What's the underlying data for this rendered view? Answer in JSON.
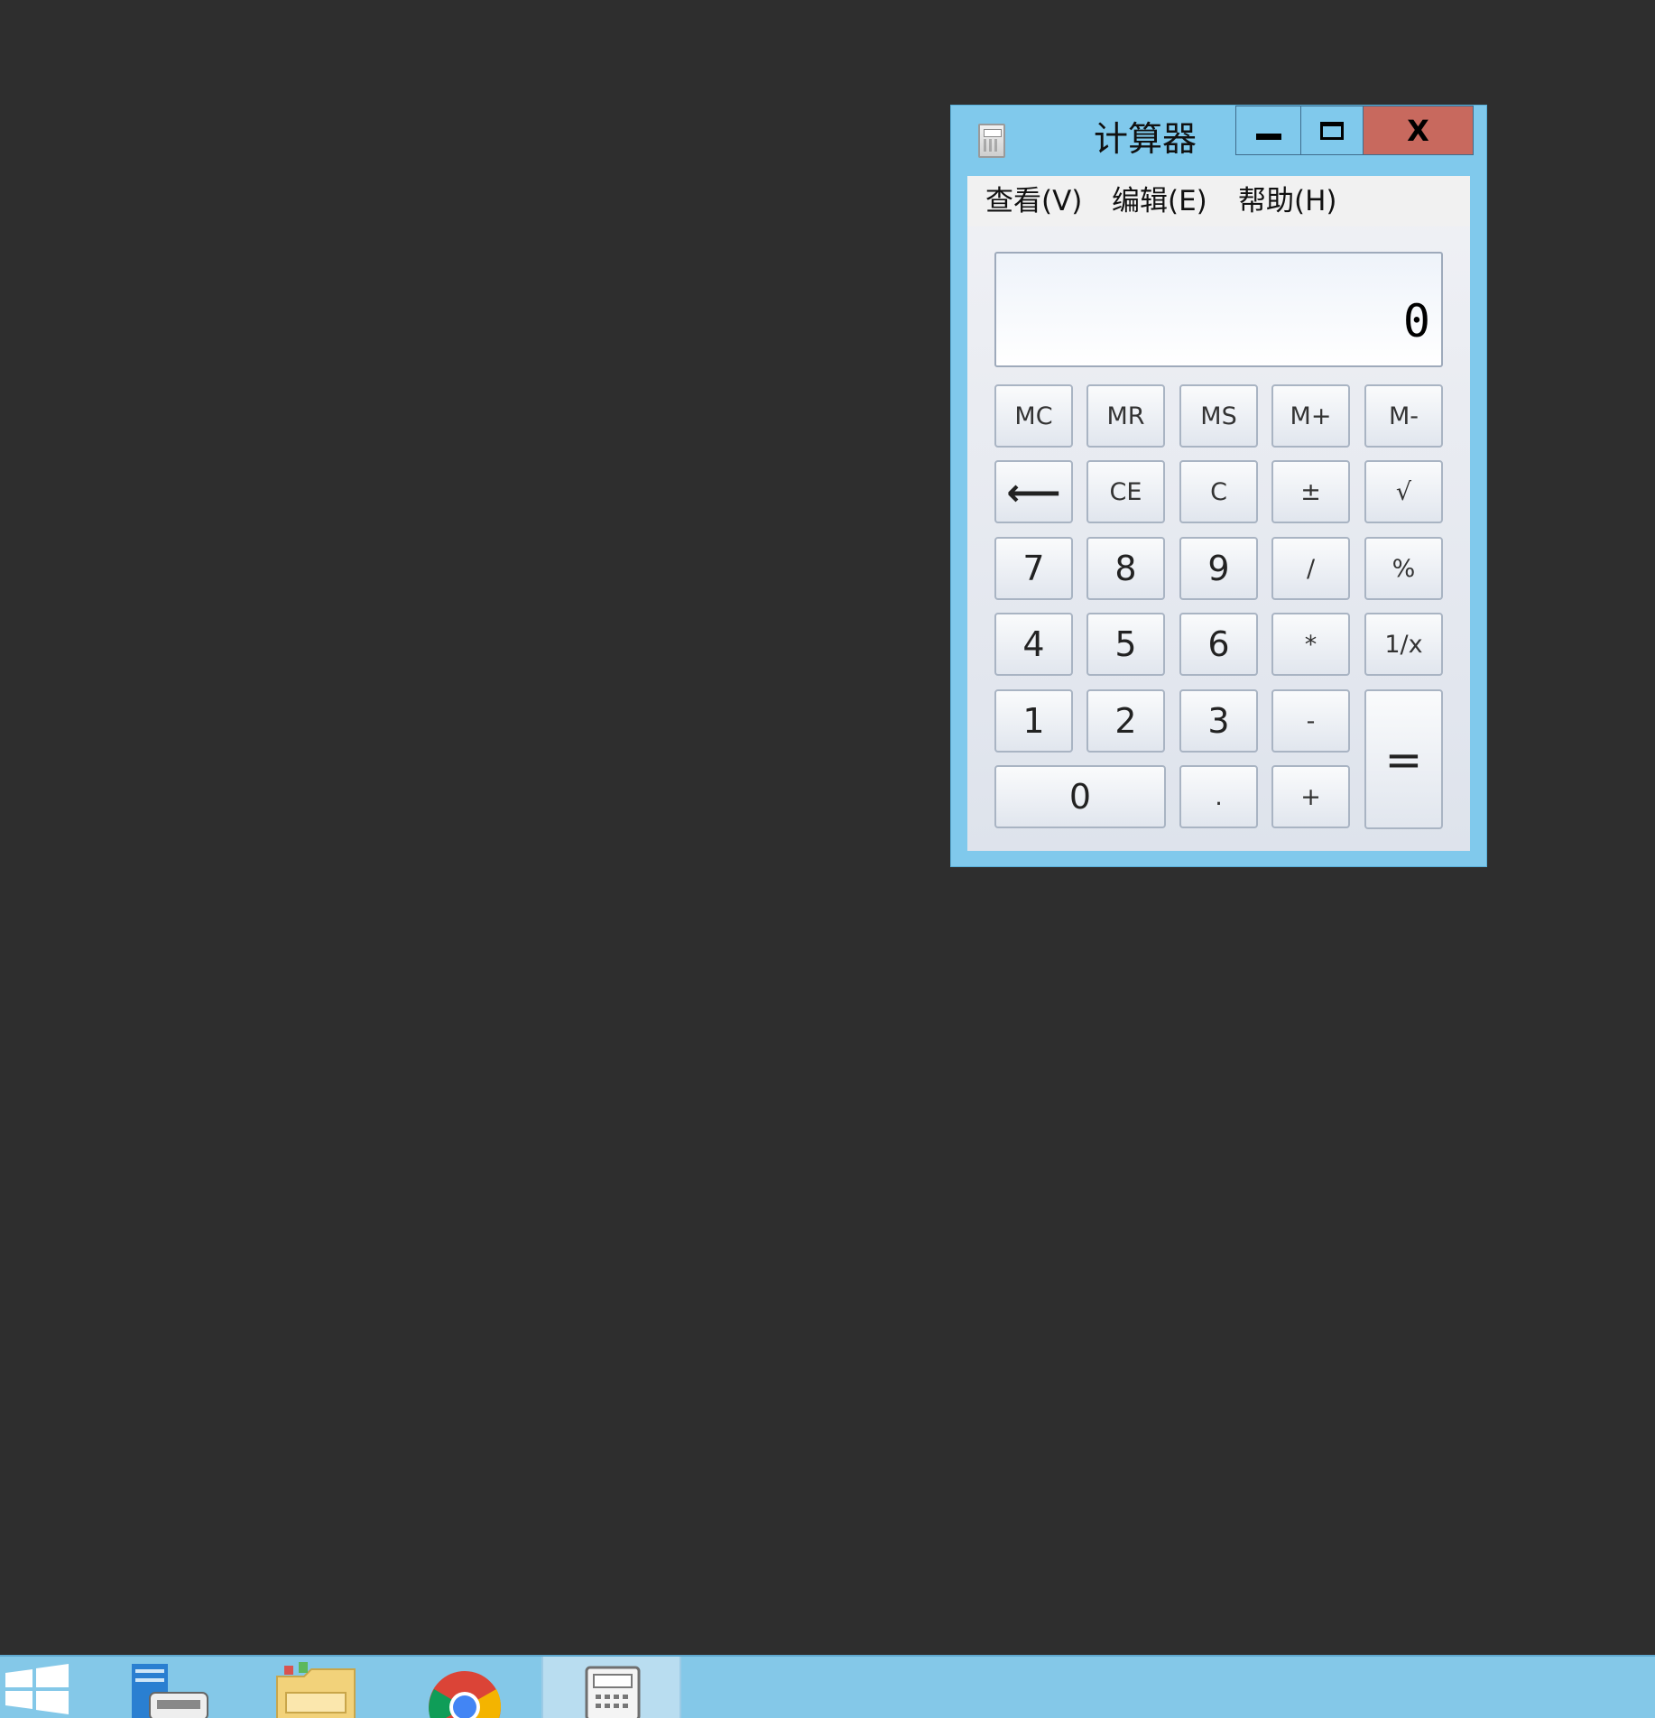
{
  "window": {
    "title": "计算器",
    "close_label": "X"
  },
  "menu": {
    "items": [
      {
        "label": "查看(V)"
      },
      {
        "label": "编辑(E)"
      },
      {
        "label": "帮助(H)"
      }
    ]
  },
  "display": {
    "value": "0"
  },
  "buttons": {
    "mc": "MC",
    "mr": "MR",
    "ms": "MS",
    "mplus": "M+",
    "mminus": "M-",
    "backspace": "⟵",
    "ce": "CE",
    "c": "C",
    "negate": "±",
    "sqrt": "√",
    "seven": "7",
    "eight": "8",
    "nine": "9",
    "divide": "/",
    "percent": "%",
    "four": "4",
    "five": "5",
    "six": "6",
    "multiply": "*",
    "reciprocal": "1/x",
    "one": "1",
    "two": "2",
    "three": "3",
    "subtract": "-",
    "equals": "=",
    "zero": "0",
    "decimal": ".",
    "add": "+"
  },
  "taskbar": {
    "items": [
      {
        "icon": "windows-start-icon"
      },
      {
        "icon": "server-manager-icon"
      },
      {
        "icon": "file-explorer-icon"
      },
      {
        "icon": "chrome-icon"
      },
      {
        "icon": "calculator-icon"
      }
    ]
  }
}
